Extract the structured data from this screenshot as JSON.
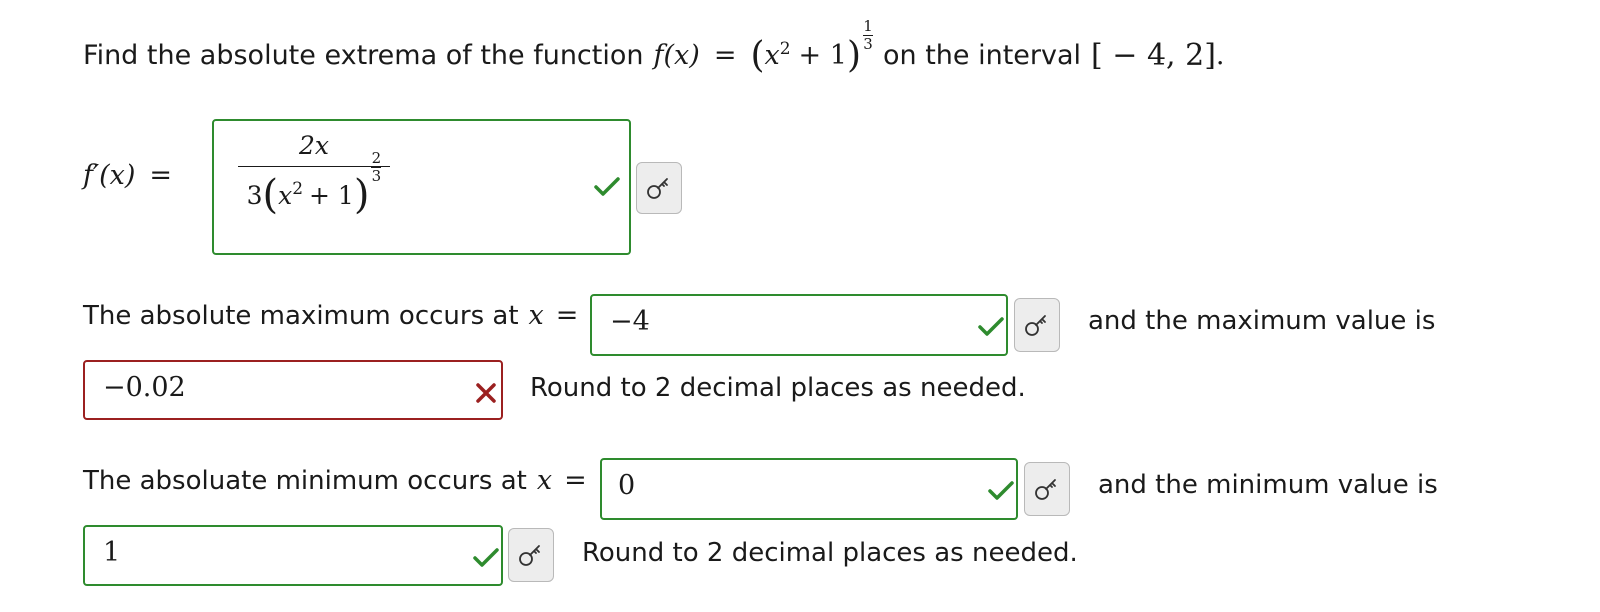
{
  "question": {
    "prefix": "Find the absolute extrema of the function",
    "func_lhs": "f(x)",
    "equals": "=",
    "base": "x",
    "base_exp": "2",
    "plus_one": "+ 1",
    "exp_num": "1",
    "exp_den": "3",
    "middle": "on the interval",
    "interval": "[ − 4, 2]",
    "period": "."
  },
  "derivative": {
    "label": "f′(x)",
    "equals": "=",
    "numerator": "2x",
    "den_coef": "3",
    "den_base": "x",
    "den_base_exp": "2",
    "den_plus": "+ 1",
    "den_exp_num": "2",
    "den_exp_den": "3",
    "status": "correct"
  },
  "max_row": {
    "text_before": "The absolute maximum occurs at",
    "var": "x",
    "equals": "=",
    "location_value": "−4",
    "location_status": "correct",
    "text_after": "and the maximum value is",
    "value": "−0.02",
    "value_status": "incorrect",
    "hint": "Round to 2 decimal places as needed."
  },
  "min_row": {
    "text_before": "The absoluate minimum occurs at",
    "var": "x",
    "equals": "=",
    "location_value": "0",
    "location_status": "correct",
    "text_after": "and the minimum value is",
    "value": "1",
    "value_status": "correct",
    "hint": "Round to 2 decimal places as needed."
  },
  "colors": {
    "correct": "#2e8b2e",
    "incorrect": "#9b2020",
    "key_button_bg": "#ededed"
  },
  "icons": {
    "correct": "check-icon",
    "incorrect": "x-icon",
    "key": "key-icon"
  }
}
